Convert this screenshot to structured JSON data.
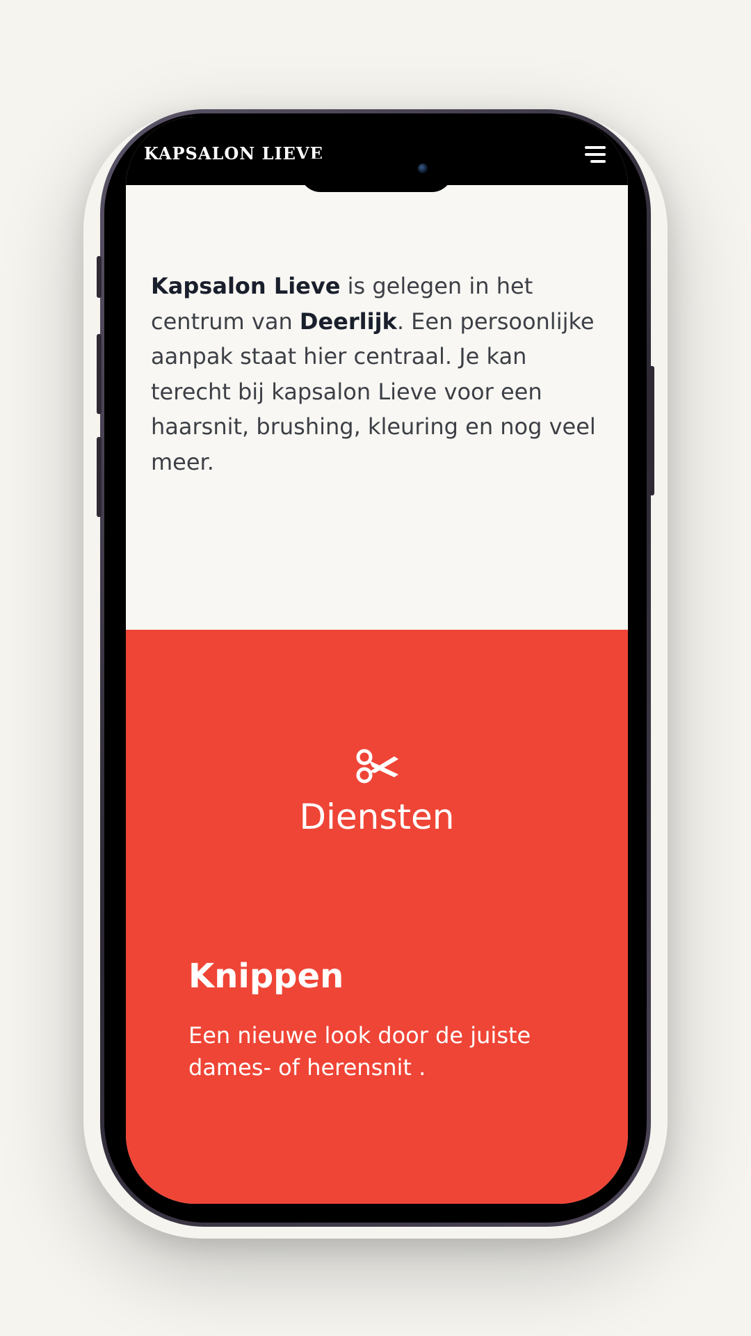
{
  "header": {
    "logo": "KAPSALON LIEVE",
    "menu_icon": "hamburger-menu-icon"
  },
  "intro": {
    "salon_name": "Kapsalon Lieve",
    "text_1": " is gelegen in het centrum van ",
    "town": "Deerlijk",
    "text_2": ". Een persoonlijke aanpak staat hier centraal. Je kan terecht bij kapsalon Lieve voor een haarsnit, brushing, kleuring en nog veel meer."
  },
  "services": {
    "icon": "scissors-icon",
    "title": "Diensten",
    "items": [
      {
        "title": "Knippen",
        "description": "Een nieuwe look door de juiste dames- of herensnit ."
      }
    ]
  },
  "colors": {
    "accent": "#ef4536",
    "page_background": "#f8f7f3",
    "header_background": "#000000"
  }
}
